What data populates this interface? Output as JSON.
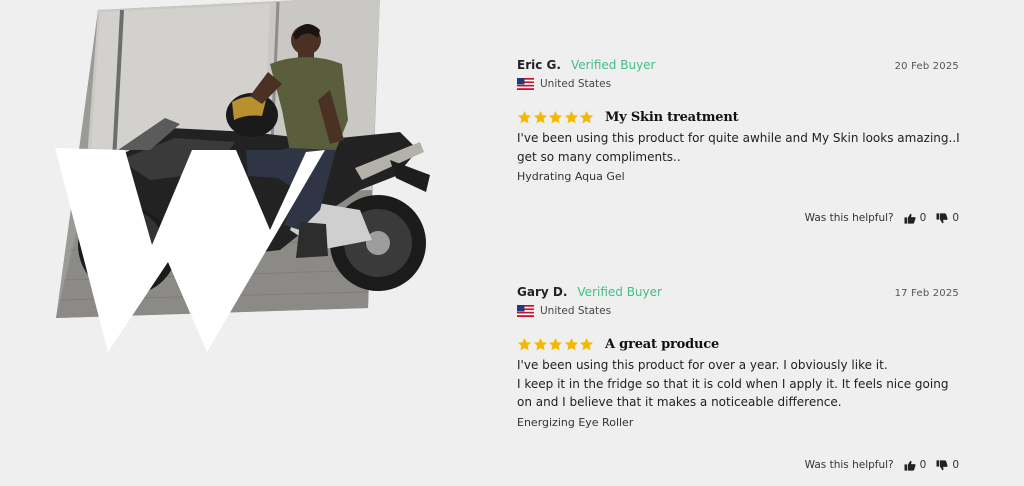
{
  "reviews": [
    {
      "author": "Eric G.",
      "verified": "Verified Buyer",
      "date": "20 Feb 2025",
      "location": "United States",
      "rating": 5,
      "title": "My Skin treatment",
      "body": [
        "I've been using this product for quite awhile and My Skin looks amazing..I",
        "get so many compliments.."
      ],
      "product": "Hydrating Aqua Gel",
      "helpful_label": "Was this helpful?",
      "helpful_up": "0",
      "helpful_down": "0"
    },
    {
      "author": "Gary D.",
      "verified": "Verified Buyer",
      "date": "17 Feb 2025",
      "location": "United States",
      "rating": 5,
      "title": "A great produce",
      "body": [
        "I've been using this product for over a year. I obviously like it.",
        "I keep it in the fridge so that it is cold when I apply it. It feels nice going",
        "on and I believe that it makes a noticeable difference."
      ],
      "product": "Energizing Eye Roller",
      "helpful_label": "Was this helpful?",
      "helpful_up": "0",
      "helpful_down": "0"
    }
  ],
  "colors": {
    "background": "#efefef",
    "verified": "#3fbf87",
    "star": "#f5b800"
  },
  "icons": {
    "flag": "us-flag-icon",
    "star": "star-icon",
    "helpful_up": "thumbs-up-icon",
    "helpful_down": "thumbs-down-icon"
  }
}
